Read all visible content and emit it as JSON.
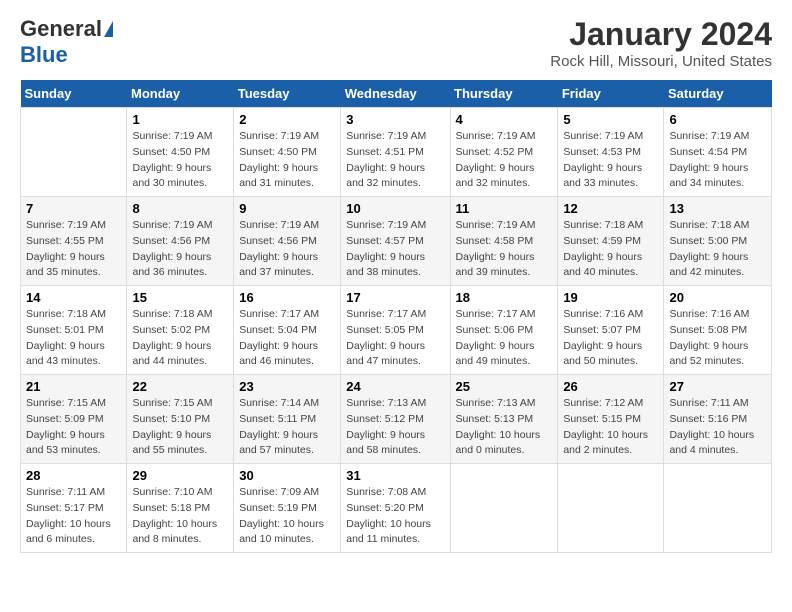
{
  "logo": {
    "general": "General",
    "blue": "Blue"
  },
  "header": {
    "title": "January 2024",
    "subtitle": "Rock Hill, Missouri, United States"
  },
  "weekdays": [
    "Sunday",
    "Monday",
    "Tuesday",
    "Wednesday",
    "Thursday",
    "Friday",
    "Saturday"
  ],
  "weeks": [
    [
      null,
      {
        "day": 1,
        "sunrise": "7:19 AM",
        "sunset": "4:50 PM",
        "daylight": "9 hours and 30 minutes."
      },
      {
        "day": 2,
        "sunrise": "7:19 AM",
        "sunset": "4:50 PM",
        "daylight": "9 hours and 31 minutes."
      },
      {
        "day": 3,
        "sunrise": "7:19 AM",
        "sunset": "4:51 PM",
        "daylight": "9 hours and 32 minutes."
      },
      {
        "day": 4,
        "sunrise": "7:19 AM",
        "sunset": "4:52 PM",
        "daylight": "9 hours and 32 minutes."
      },
      {
        "day": 5,
        "sunrise": "7:19 AM",
        "sunset": "4:53 PM",
        "daylight": "9 hours and 33 minutes."
      },
      {
        "day": 6,
        "sunrise": "7:19 AM",
        "sunset": "4:54 PM",
        "daylight": "9 hours and 34 minutes."
      }
    ],
    [
      {
        "day": 7,
        "sunrise": "7:19 AM",
        "sunset": "4:55 PM",
        "daylight": "9 hours and 35 minutes."
      },
      {
        "day": 8,
        "sunrise": "7:19 AM",
        "sunset": "4:56 PM",
        "daylight": "9 hours and 36 minutes."
      },
      {
        "day": 9,
        "sunrise": "7:19 AM",
        "sunset": "4:56 PM",
        "daylight": "9 hours and 37 minutes."
      },
      {
        "day": 10,
        "sunrise": "7:19 AM",
        "sunset": "4:57 PM",
        "daylight": "9 hours and 38 minutes."
      },
      {
        "day": 11,
        "sunrise": "7:19 AM",
        "sunset": "4:58 PM",
        "daylight": "9 hours and 39 minutes."
      },
      {
        "day": 12,
        "sunrise": "7:18 AM",
        "sunset": "4:59 PM",
        "daylight": "9 hours and 40 minutes."
      },
      {
        "day": 13,
        "sunrise": "7:18 AM",
        "sunset": "5:00 PM",
        "daylight": "9 hours and 42 minutes."
      }
    ],
    [
      {
        "day": 14,
        "sunrise": "7:18 AM",
        "sunset": "5:01 PM",
        "daylight": "9 hours and 43 minutes."
      },
      {
        "day": 15,
        "sunrise": "7:18 AM",
        "sunset": "5:02 PM",
        "daylight": "9 hours and 44 minutes."
      },
      {
        "day": 16,
        "sunrise": "7:17 AM",
        "sunset": "5:04 PM",
        "daylight": "9 hours and 46 minutes."
      },
      {
        "day": 17,
        "sunrise": "7:17 AM",
        "sunset": "5:05 PM",
        "daylight": "9 hours and 47 minutes."
      },
      {
        "day": 18,
        "sunrise": "7:17 AM",
        "sunset": "5:06 PM",
        "daylight": "9 hours and 49 minutes."
      },
      {
        "day": 19,
        "sunrise": "7:16 AM",
        "sunset": "5:07 PM",
        "daylight": "9 hours and 50 minutes."
      },
      {
        "day": 20,
        "sunrise": "7:16 AM",
        "sunset": "5:08 PM",
        "daylight": "9 hours and 52 minutes."
      }
    ],
    [
      {
        "day": 21,
        "sunrise": "7:15 AM",
        "sunset": "5:09 PM",
        "daylight": "9 hours and 53 minutes."
      },
      {
        "day": 22,
        "sunrise": "7:15 AM",
        "sunset": "5:10 PM",
        "daylight": "9 hours and 55 minutes."
      },
      {
        "day": 23,
        "sunrise": "7:14 AM",
        "sunset": "5:11 PM",
        "daylight": "9 hours and 57 minutes."
      },
      {
        "day": 24,
        "sunrise": "7:13 AM",
        "sunset": "5:12 PM",
        "daylight": "9 hours and 58 minutes."
      },
      {
        "day": 25,
        "sunrise": "7:13 AM",
        "sunset": "5:13 PM",
        "daylight": "10 hours and 0 minutes."
      },
      {
        "day": 26,
        "sunrise": "7:12 AM",
        "sunset": "5:15 PM",
        "daylight": "10 hours and 2 minutes."
      },
      {
        "day": 27,
        "sunrise": "7:11 AM",
        "sunset": "5:16 PM",
        "daylight": "10 hours and 4 minutes."
      }
    ],
    [
      {
        "day": 28,
        "sunrise": "7:11 AM",
        "sunset": "5:17 PM",
        "daylight": "10 hours and 6 minutes."
      },
      {
        "day": 29,
        "sunrise": "7:10 AM",
        "sunset": "5:18 PM",
        "daylight": "10 hours and 8 minutes."
      },
      {
        "day": 30,
        "sunrise": "7:09 AM",
        "sunset": "5:19 PM",
        "daylight": "10 hours and 10 minutes."
      },
      {
        "day": 31,
        "sunrise": "7:08 AM",
        "sunset": "5:20 PM",
        "daylight": "10 hours and 11 minutes."
      },
      null,
      null,
      null
    ]
  ]
}
